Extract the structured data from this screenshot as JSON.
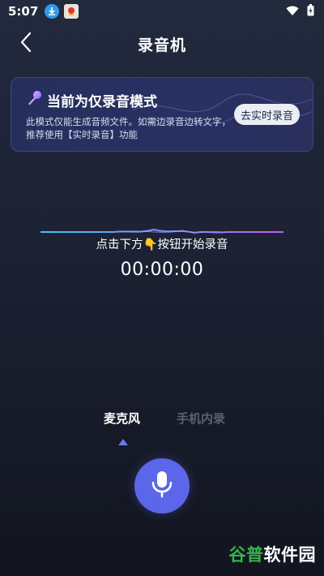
{
  "status_bar": {
    "time": "5:07",
    "icons": [
      "download-icon",
      "app-notification-icon",
      "wifi-icon",
      "battery-icon"
    ]
  },
  "header": {
    "title": "录音机",
    "back_icon": "chevron-left-icon"
  },
  "mode_card": {
    "icon": "microphone-icon",
    "title": "当前为仅录音模式",
    "description": "此模式仅能生成音频文件。如需边录音边转文字，推荐使用【实时录音】功能",
    "realtime_button_label": "去实时录音"
  },
  "recorder": {
    "hint": "点击下方👇按钮开始录音",
    "timer": "00:00:00"
  },
  "tabs": [
    {
      "label": "麦克风",
      "active": true
    },
    {
      "label": "手机内录",
      "active": false
    }
  ],
  "record_button": {
    "icon": "microphone-icon"
  },
  "watermark": {
    "part_a": "谷普",
    "part_b": "软件园"
  },
  "colors": {
    "accent": "#5b66e8",
    "tab_inactive": "#5b6075",
    "watermark_green": "#37b34a"
  }
}
